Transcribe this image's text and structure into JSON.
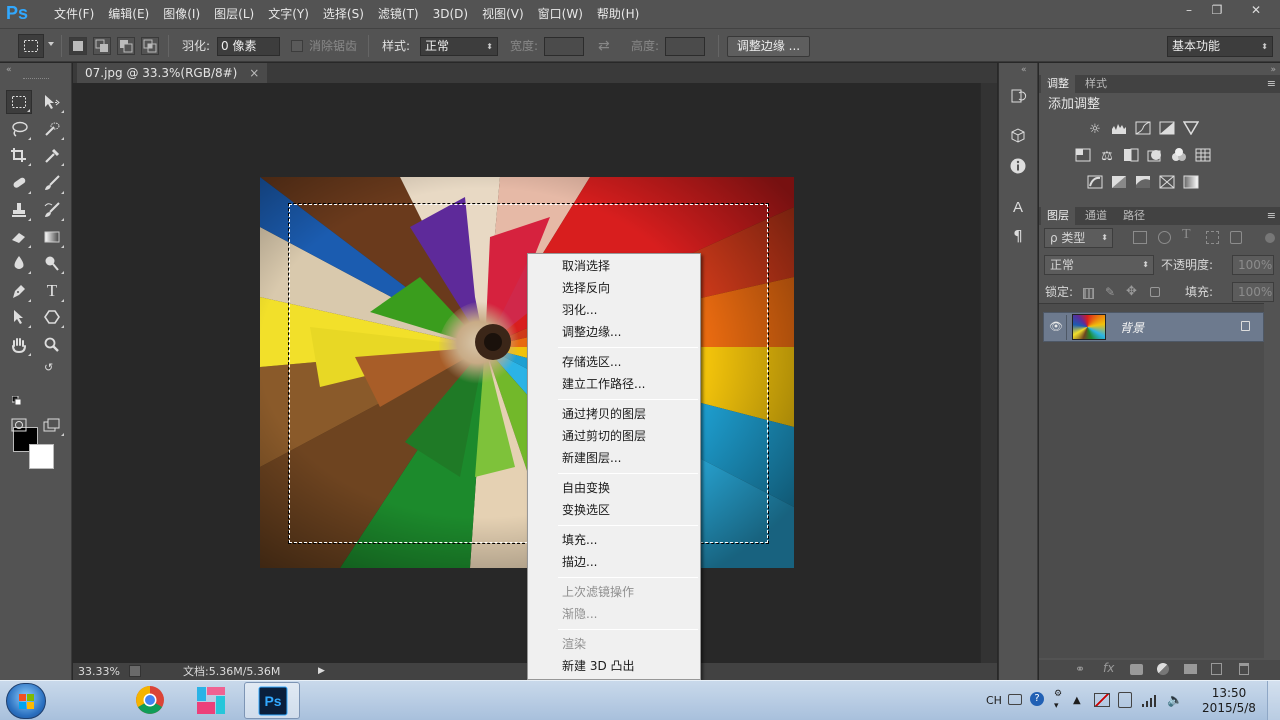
{
  "app": {
    "logo": "Ps"
  },
  "menubar": {
    "items": [
      "文件(F)",
      "编辑(E)",
      "图像(I)",
      "图层(L)",
      "文字(Y)",
      "选择(S)",
      "滤镜(T)",
      "3D(D)",
      "视图(V)",
      "窗口(W)",
      "帮助(H)"
    ]
  },
  "window_controls": {
    "minimize": "–",
    "restore": "❐",
    "close": "✕"
  },
  "options": {
    "feather_label": "羽化:",
    "feather_value": "0 像素",
    "antialias_label": "消除锯齿",
    "style_label": "样式:",
    "style_value": "正常",
    "width_label": "宽度:",
    "height_label": "高度:",
    "refine_edge_button": "调整边缘 ...",
    "workspace_value": "基本功能"
  },
  "document": {
    "tab_title": "07.jpg @ 33.3%(RGB/8#)",
    "tab_close": "×",
    "zoom": "33.33%",
    "doc_size": "文档:5.36M/5.36M"
  },
  "context_menu": {
    "groups": [
      [
        "取消选择",
        "选择反向",
        "羽化...",
        "调整边缘..."
      ],
      [
        "存储选区...",
        "建立工作路径..."
      ],
      [
        "通过拷贝的图层",
        "通过剪切的图层",
        "新建图层..."
      ],
      [
        "自由变换",
        "变换选区"
      ],
      [
        "填充...",
        "描边..."
      ],
      [
        "上次滤镜操作",
        "渐隐..."
      ],
      [
        "渲染",
        "新建 3D 凸出"
      ]
    ],
    "disabled": [
      "上次滤镜操作",
      "渐隐...",
      "渲染"
    ]
  },
  "panels": {
    "adjust_tabs": [
      "调整",
      "样式"
    ],
    "adjust_title": "添加调整",
    "layer_tabs": [
      "图层",
      "通道",
      "路径"
    ],
    "filter_kind": "ρ 类型",
    "blend_mode": "正常",
    "opacity_label": "不透明度:",
    "opacity_value": "100%",
    "lock_label": "锁定:",
    "fill_label": "填充:",
    "fill_value": "100%",
    "layer_name": "背景"
  },
  "taskbar": {
    "lang": "CH",
    "time": "13:50",
    "date": "2015/5/8"
  },
  "colors": {
    "ps_blue": "#31a8ff",
    "panel_bg": "#535353",
    "canvas_bg": "#282828",
    "selected_layer": "#6d7a8e",
    "menu_bg": "#f0f0f0"
  }
}
